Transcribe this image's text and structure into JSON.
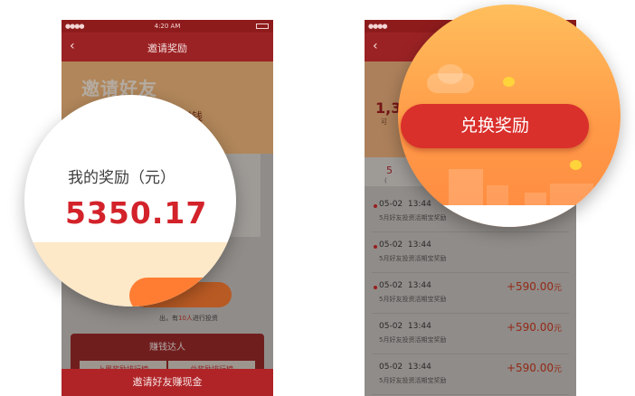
{
  "status_bar": {
    "time": "4:20 AM"
  },
  "left_screen": {
    "nav": {
      "back_icon": "chevron-left",
      "title": "邀请奖励"
    },
    "banner": {
      "title": "邀请好友",
      "word": "赚钱",
      "number": "3"
    },
    "invite_text": {
      "prefix": "出，有",
      "highlight": "10人",
      "suffix": "进行投资"
    },
    "earners": {
      "title": "赚钱达人",
      "tabs": [
        "上周奖励排行榜",
        "总奖励排行榜"
      ]
    },
    "bottom_button": "邀请好友赚现金"
  },
  "left_magnifier": {
    "label": "我的奖励（元）",
    "value": "5350.17"
  },
  "right_screen": {
    "nav": {
      "back_icon": "chevron-left"
    },
    "banner": {
      "amount": "1,3",
      "note": "可"
    },
    "stat": {
      "value": "5",
      "label": "("
    },
    "records": [
      {
        "date": "05-02",
        "time": "13:44",
        "desc": "5月好友投资活期宝奖励",
        "amount": "",
        "unit": "",
        "unread": true
      },
      {
        "date": "05-02",
        "time": "13:44",
        "desc": "5月好友投资活期宝奖励",
        "amount": "",
        "unit": "",
        "unread": true
      },
      {
        "date": "05-02",
        "time": "13:44",
        "desc": "5月好友投资活期宝奖励",
        "amount": "+590.00",
        "unit": "元",
        "unread": true
      },
      {
        "date": "05-02",
        "time": "13:44",
        "desc": "5月好友投资活期宝奖励",
        "amount": "+590.00",
        "unit": "元",
        "unread": false
      },
      {
        "date": "05-02",
        "time": "13:44",
        "desc": "5月好友投资活期宝奖励",
        "amount": "+590.00",
        "unit": "元",
        "unread": false
      }
    ]
  },
  "right_magnifier": {
    "button_label": "兑换奖励"
  },
  "colors": {
    "brand_red": "#d3222a",
    "nav_red": "#9b2224",
    "accent_orange": "#ff7d33"
  }
}
